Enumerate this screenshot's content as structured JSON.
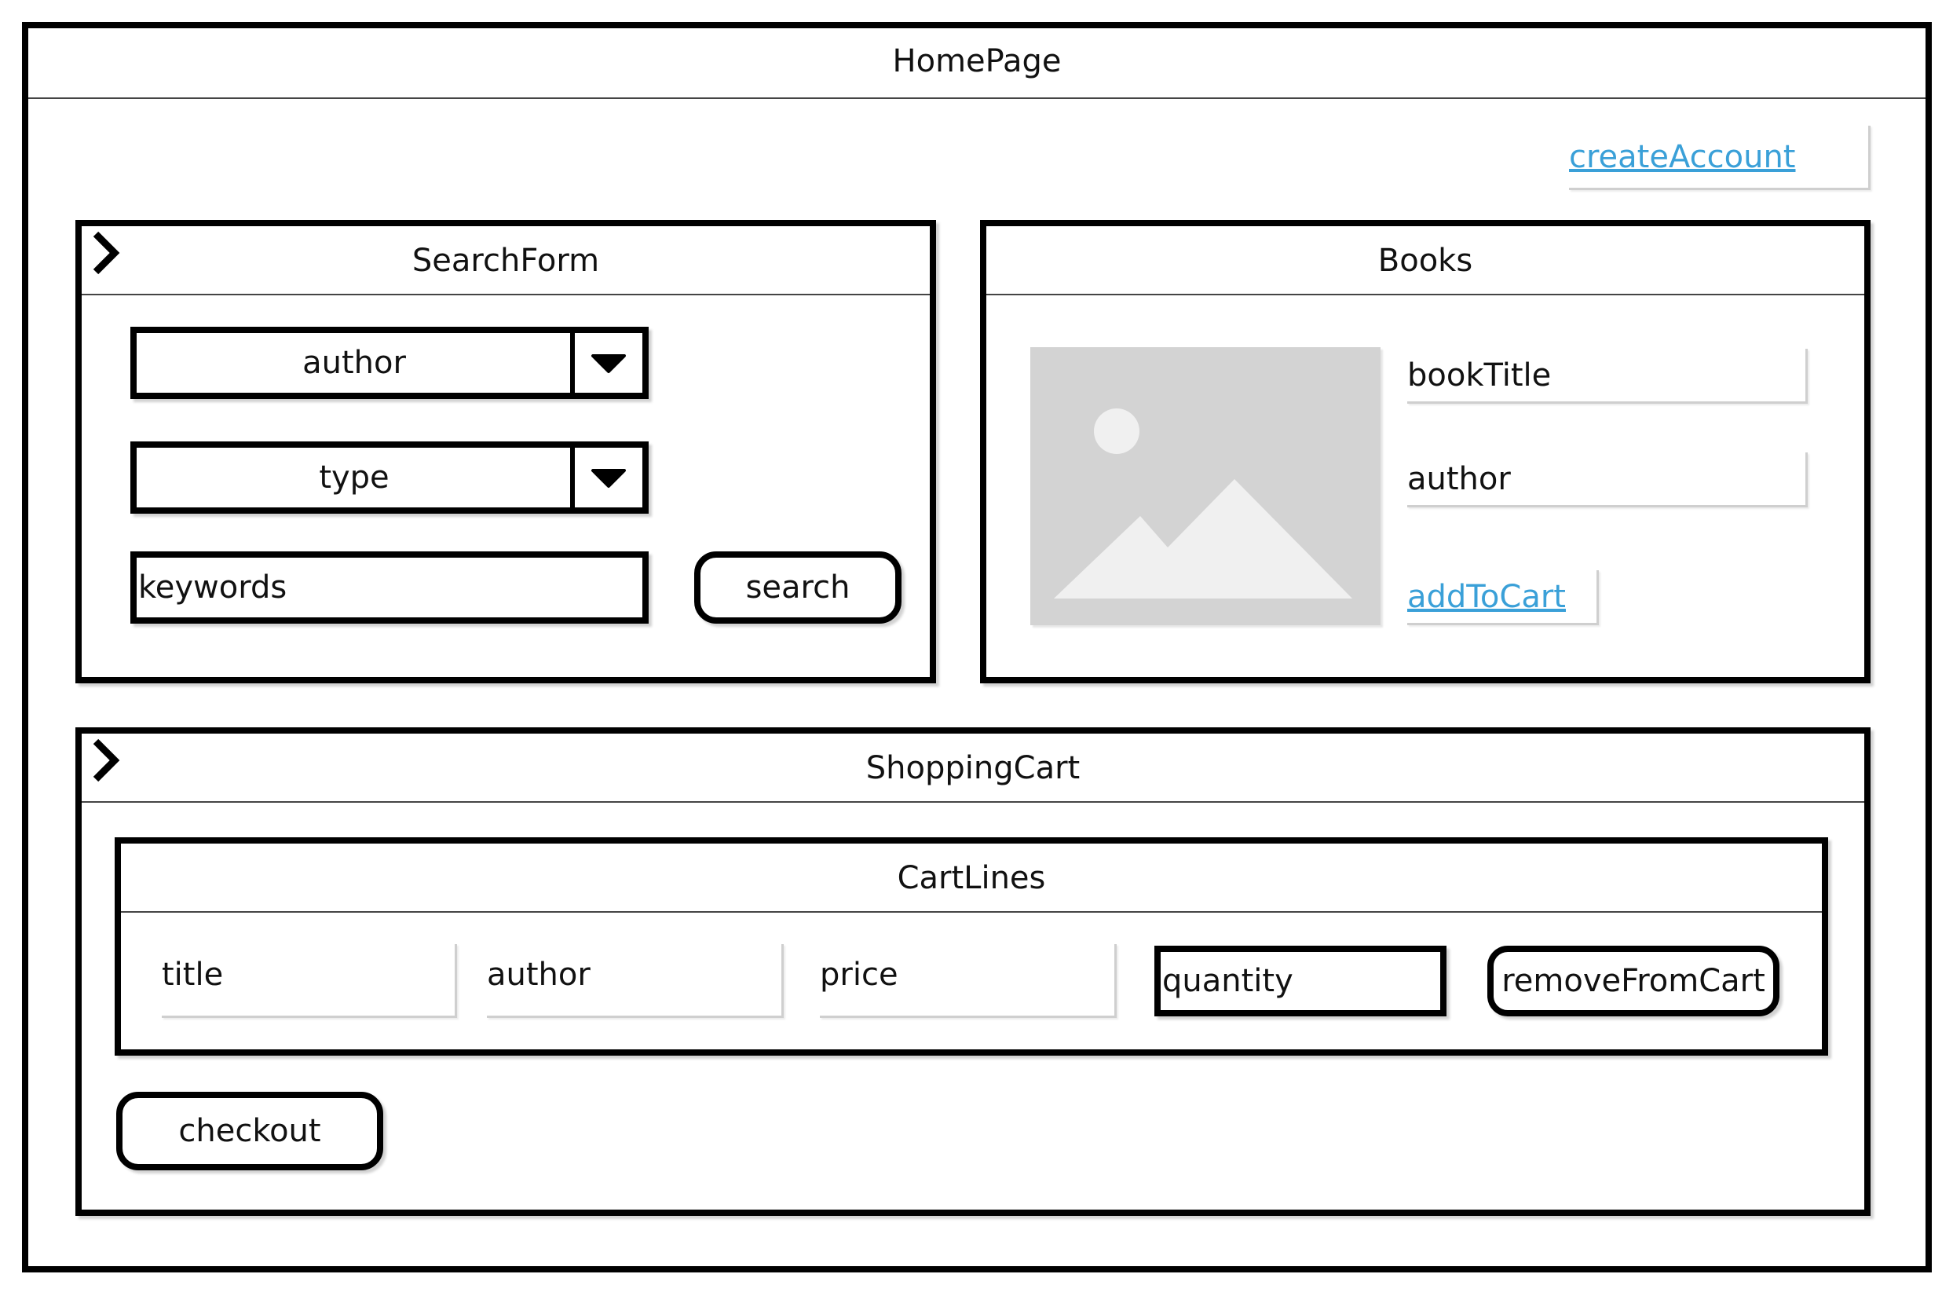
{
  "homepage": {
    "title": "HomePage",
    "create_account_link": "createAccount"
  },
  "search_form": {
    "title": "SearchForm",
    "author_select": "author",
    "type_select": "type",
    "keywords_input": "keywords",
    "search_button": "search"
  },
  "books": {
    "title": "Books",
    "book_title": "bookTitle",
    "author": "author",
    "add_to_cart_link": "addToCart"
  },
  "shopping_cart": {
    "title": "ShoppingCart",
    "cart_lines": {
      "title": "CartLines",
      "title_label": "title",
      "author_label": "author",
      "price_label": "price",
      "quantity_input": "quantity",
      "remove_button": "removeFromCart"
    },
    "checkout_button": "checkout"
  },
  "colors": {
    "link": "#3aa0d8",
    "image_placeholder": "#d3d3d3"
  }
}
